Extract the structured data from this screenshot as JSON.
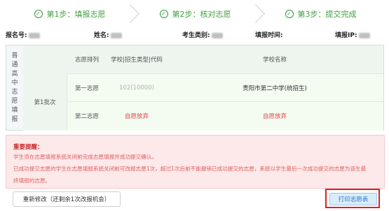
{
  "steps": [
    {
      "label": "第1步：填报志愿",
      "done": true
    },
    {
      "label": "第2步：核对志愿",
      "done": true
    },
    {
      "label": "第3步：提交完成",
      "done": true
    }
  ],
  "info": {
    "reg_label": "报名号:",
    "name_label": "姓名:",
    "cat_label": "考生类别:",
    "time_label": "填报时间:",
    "ip_label": "填报IP:"
  },
  "table": {
    "side_title": [
      "普",
      "通",
      "高",
      "中",
      "志",
      "愿",
      "填",
      "报"
    ],
    "headers": {
      "order": "志愿排列",
      "code": "学校|招生类型|代码",
      "name": "学校名称"
    },
    "batch": "第1批次",
    "rows": [
      {
        "order": "第一志愿",
        "code": "102(10000)",
        "school": "贵阳市第二中学(统招生)"
      },
      {
        "order": "第二志愿",
        "code": "自愿放弃",
        "school": "自愿放弃"
      }
    ]
  },
  "notice": {
    "title": "重要提醒：",
    "lines": [
      "学生须在志愿填报系统关闭前完成志愿填报并成功提交确认。",
      "已成功提交志愿的学生在志愿填报系统关闭前可改报志愿1次，超过1次后前不能撤销已成功提交的志愿，系统以学生最后一次成功提交的志愿为该生最",
      "终填报的志愿。"
    ]
  },
  "buttons": {
    "retry": "重新修改（还剩余1次改报机会）",
    "print": "打印志愿表"
  },
  "colors": {
    "green": "#2f9a3a",
    "red_border": "#e02020",
    "print_text": "#2a77c9"
  }
}
